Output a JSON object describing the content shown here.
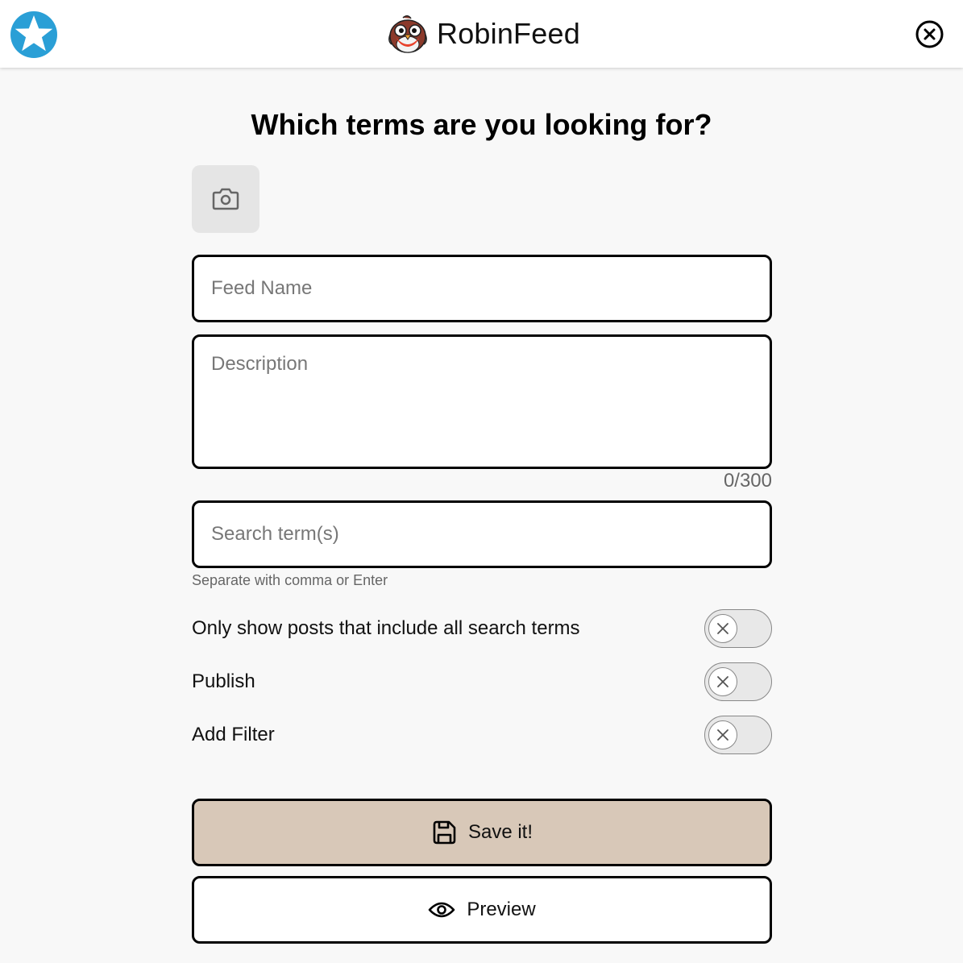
{
  "header": {
    "app_name": "RobinFeed",
    "left_icon": "star-badge-icon",
    "logo_icon": "robin-bird-icon",
    "close_icon": "close-circle-icon"
  },
  "form": {
    "title": "Which terms are you looking for?",
    "photo_button_icon": "camera-icon",
    "feed_name_placeholder": "Feed Name",
    "feed_name_value": "",
    "description_placeholder": "Description",
    "description_value": "",
    "char_count": "0/300",
    "search_placeholder": "Search term(s)",
    "search_value": "",
    "search_helper": "Separate with comma or Enter",
    "toggles": [
      {
        "label": "Only show posts that include all search terms",
        "checked": false
      },
      {
        "label": "Publish",
        "checked": false
      },
      {
        "label": "Add Filter",
        "checked": false
      }
    ],
    "save_label": "Save it!",
    "save_icon": "floppy-disk-icon",
    "preview_label": "Preview",
    "preview_icon": "eye-icon"
  },
  "colors": {
    "page_background": "#f8f8f8",
    "header_background": "#ffffff",
    "star_badge": "#2a9fd6",
    "save_button": "#d8c8b8",
    "field_border": "#000000",
    "placeholder": "#777777"
  }
}
